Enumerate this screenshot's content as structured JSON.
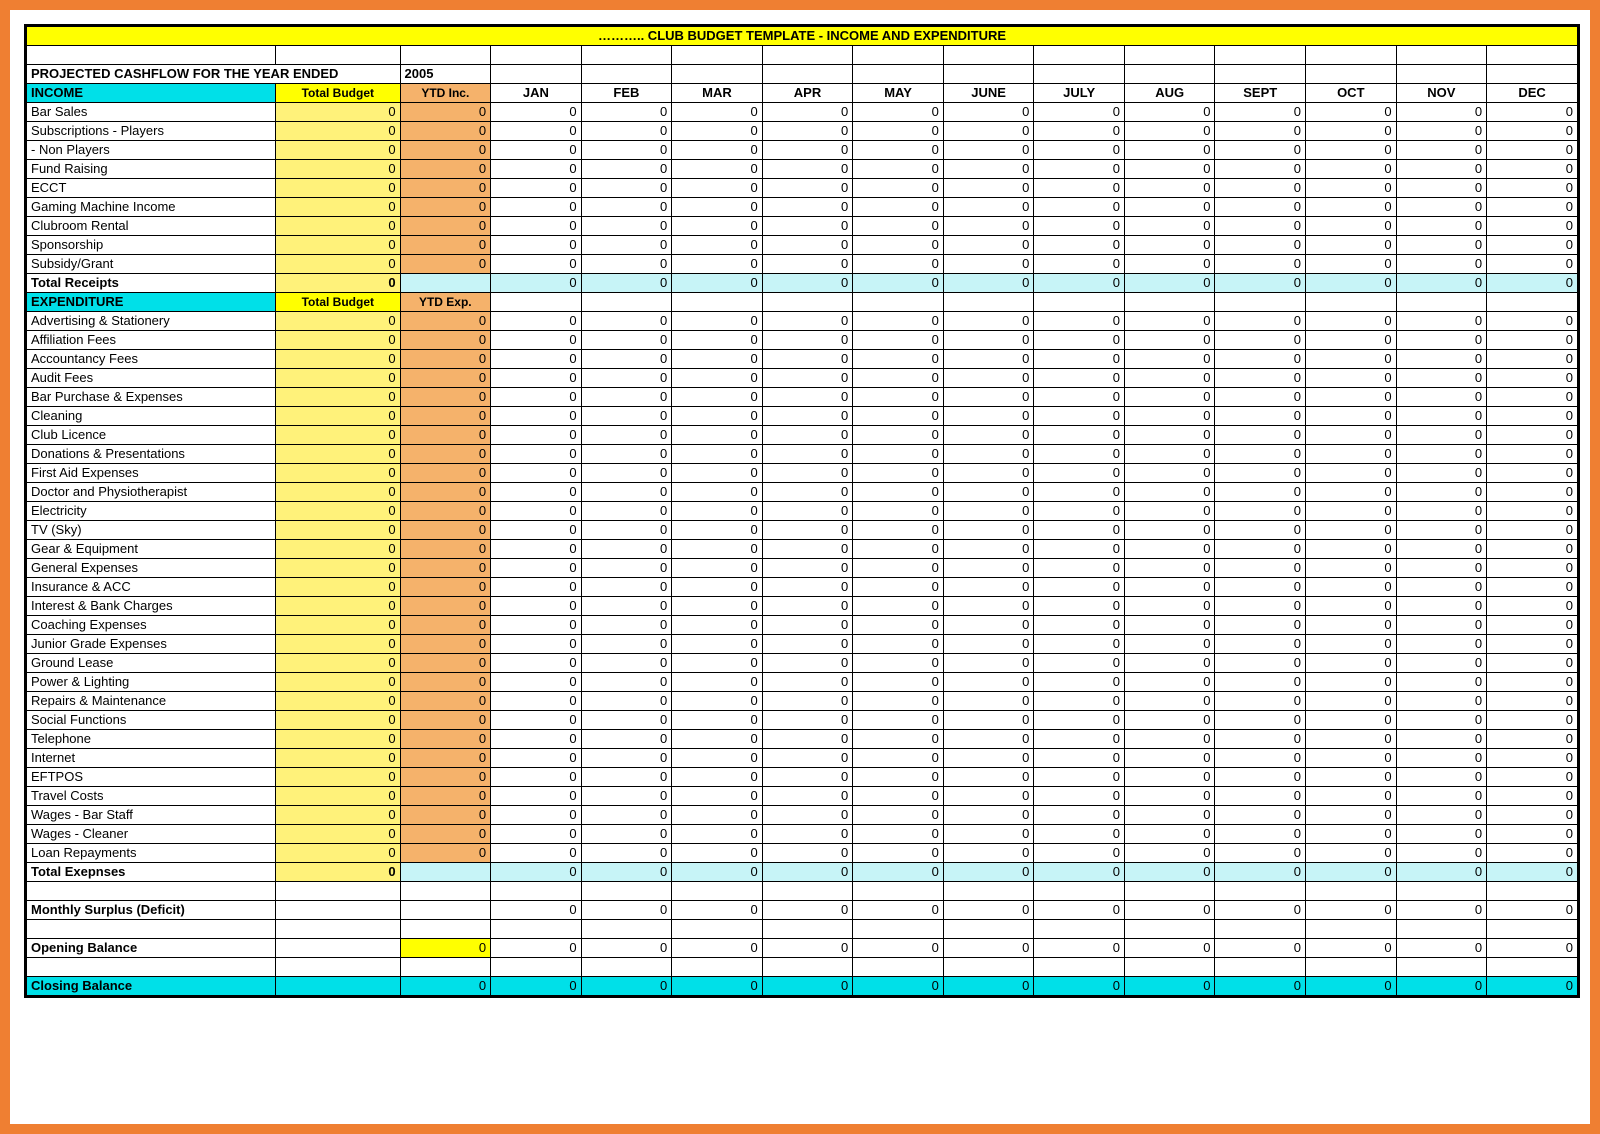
{
  "title": "………..  CLUB BUDGET TEMPLATE - INCOME AND EXPENDITURE",
  "projected_line": {
    "prefix": "PROJECTED CASHFLOW FOR THE YEAR ENDED",
    "year": "2005"
  },
  "headers": {
    "income_section": "INCOME",
    "expenditure_section": "EXPENDITURE",
    "total_budget": "Total Budget",
    "ytd_inc": "YTD Inc.",
    "ytd_exp": "YTD Exp.",
    "months": [
      "JAN",
      "FEB",
      "MAR",
      "APR",
      "MAY",
      "JUNE",
      "JULY",
      "AUG",
      "SEPT",
      "OCT",
      "NOV",
      "DEC"
    ]
  },
  "income_rows": [
    {
      "label": "Bar Sales",
      "tbud": "0",
      "ytd": "0",
      "m": [
        "0",
        "0",
        "0",
        "0",
        "0",
        "0",
        "0",
        "0",
        "0",
        "0",
        "0",
        "0"
      ]
    },
    {
      "label": "Subscriptions - Players",
      "tbud": "0",
      "ytd": "0",
      "m": [
        "0",
        "0",
        "0",
        "0",
        "0",
        "0",
        "0",
        "0",
        "0",
        "0",
        "0",
        "0"
      ]
    },
    {
      "label": "- Non Players",
      "indent": true,
      "tbud": "0",
      "ytd": "0",
      "m": [
        "0",
        "0",
        "0",
        "0",
        "0",
        "0",
        "0",
        "0",
        "0",
        "0",
        "0",
        "0"
      ]
    },
    {
      "label": "Fund Raising",
      "tbud": "0",
      "ytd": "0",
      "m": [
        "0",
        "0",
        "0",
        "0",
        "0",
        "0",
        "0",
        "0",
        "0",
        "0",
        "0",
        "0"
      ]
    },
    {
      "label": "ECCT",
      "tbud": "0",
      "ytd": "0",
      "m": [
        "0",
        "0",
        "0",
        "0",
        "0",
        "0",
        "0",
        "0",
        "0",
        "0",
        "0",
        "0"
      ]
    },
    {
      "label": "Gaming Machine Income",
      "tbud": "0",
      "ytd": "0",
      "m": [
        "0",
        "0",
        "0",
        "0",
        "0",
        "0",
        "0",
        "0",
        "0",
        "0",
        "0",
        "0"
      ]
    },
    {
      "label": "Clubroom Rental",
      "tbud": "0",
      "ytd": "0",
      "m": [
        "0",
        "0",
        "0",
        "0",
        "0",
        "0",
        "0",
        "0",
        "0",
        "0",
        "0",
        "0"
      ]
    },
    {
      "label": "Sponsorship",
      "tbud": "0",
      "ytd": "0",
      "m": [
        "0",
        "0",
        "0",
        "0",
        "0",
        "0",
        "0",
        "0",
        "0",
        "0",
        "0",
        "0"
      ]
    },
    {
      "label": "Subsidy/Grant",
      "tbud": "0",
      "ytd": "0",
      "m": [
        "0",
        "0",
        "0",
        "0",
        "0",
        "0",
        "0",
        "0",
        "0",
        "0",
        "0",
        "0"
      ]
    }
  ],
  "income_total": {
    "label": "Total Receipts",
    "tbud": "0",
    "ytd": "",
    "m": [
      "0",
      "0",
      "0",
      "0",
      "0",
      "0",
      "0",
      "0",
      "0",
      "0",
      "0",
      "0"
    ]
  },
  "expenditure_rows": [
    {
      "label": "Advertising & Stationery",
      "tbud": "0",
      "ytd": "0",
      "m": [
        "0",
        "0",
        "0",
        "0",
        "0",
        "0",
        "0",
        "0",
        "0",
        "0",
        "0",
        "0"
      ]
    },
    {
      "label": "Affiliation Fees",
      "tbud": "0",
      "ytd": "0",
      "m": [
        "0",
        "0",
        "0",
        "0",
        "0",
        "0",
        "0",
        "0",
        "0",
        "0",
        "0",
        "0"
      ]
    },
    {
      "label": "Accountancy Fees",
      "tbud": "0",
      "ytd": "0",
      "m": [
        "0",
        "0",
        "0",
        "0",
        "0",
        "0",
        "0",
        "0",
        "0",
        "0",
        "0",
        "0"
      ]
    },
    {
      "label": "Audit Fees",
      "tbud": "0",
      "ytd": "0",
      "m": [
        "0",
        "0",
        "0",
        "0",
        "0",
        "0",
        "0",
        "0",
        "0",
        "0",
        "0",
        "0"
      ]
    },
    {
      "label": "Bar Purchase & Expenses",
      "tbud": "0",
      "ytd": "0",
      "m": [
        "0",
        "0",
        "0",
        "0",
        "0",
        "0",
        "0",
        "0",
        "0",
        "0",
        "0",
        "0"
      ]
    },
    {
      "label": "Cleaning",
      "tbud": "0",
      "ytd": "0",
      "m": [
        "0",
        "0",
        "0",
        "0",
        "0",
        "0",
        "0",
        "0",
        "0",
        "0",
        "0",
        "0"
      ]
    },
    {
      "label": "Club Licence",
      "tbud": "0",
      "ytd": "0",
      "m": [
        "0",
        "0",
        "0",
        "0",
        "0",
        "0",
        "0",
        "0",
        "0",
        "0",
        "0",
        "0"
      ]
    },
    {
      "label": "Donations & Presentations",
      "tbud": "0",
      "ytd": "0",
      "m": [
        "0",
        "0",
        "0",
        "0",
        "0",
        "0",
        "0",
        "0",
        "0",
        "0",
        "0",
        "0"
      ]
    },
    {
      "label": "First Aid Expenses",
      "tbud": "0",
      "ytd": "0",
      "m": [
        "0",
        "0",
        "0",
        "0",
        "0",
        "0",
        "0",
        "0",
        "0",
        "0",
        "0",
        "0"
      ]
    },
    {
      "label": "Doctor and Physiotherapist",
      "tbud": "0",
      "ytd": "0",
      "m": [
        "0",
        "0",
        "0",
        "0",
        "0",
        "0",
        "0",
        "0",
        "0",
        "0",
        "0",
        "0"
      ]
    },
    {
      "label": "Electricity",
      "tbud": "0",
      "ytd": "0",
      "m": [
        "0",
        "0",
        "0",
        "0",
        "0",
        "0",
        "0",
        "0",
        "0",
        "0",
        "0",
        "0"
      ]
    },
    {
      "label": "TV (Sky)",
      "tbud": "0",
      "ytd": "0",
      "m": [
        "0",
        "0",
        "0",
        "0",
        "0",
        "0",
        "0",
        "0",
        "0",
        "0",
        "0",
        "0"
      ]
    },
    {
      "label": "Gear & Equipment",
      "tbud": "0",
      "ytd": "0",
      "m": [
        "0",
        "0",
        "0",
        "0",
        "0",
        "0",
        "0",
        "0",
        "0",
        "0",
        "0",
        "0"
      ]
    },
    {
      "label": "General Expenses",
      "tbud": "0",
      "ytd": "0",
      "m": [
        "0",
        "0",
        "0",
        "0",
        "0",
        "0",
        "0",
        "0",
        "0",
        "0",
        "0",
        "0"
      ]
    },
    {
      "label": "Insurance & ACC",
      "tbud": "0",
      "ytd": "0",
      "m": [
        "0",
        "0",
        "0",
        "0",
        "0",
        "0",
        "0",
        "0",
        "0",
        "0",
        "0",
        "0"
      ]
    },
    {
      "label": "Interest & Bank Charges",
      "tbud": "0",
      "ytd": "0",
      "m": [
        "0",
        "0",
        "0",
        "0",
        "0",
        "0",
        "0",
        "0",
        "0",
        "0",
        "0",
        "0"
      ]
    },
    {
      "label": "Coaching Expenses",
      "tbud": "0",
      "ytd": "0",
      "m": [
        "0",
        "0",
        "0",
        "0",
        "0",
        "0",
        "0",
        "0",
        "0",
        "0",
        "0",
        "0"
      ]
    },
    {
      "label": "Junior Grade Expenses",
      "tbud": "0",
      "ytd": "0",
      "m": [
        "0",
        "0",
        "0",
        "0",
        "0",
        "0",
        "0",
        "0",
        "0",
        "0",
        "0",
        "0"
      ]
    },
    {
      "label": "Ground Lease",
      "tbud": "0",
      "ytd": "0",
      "m": [
        "0",
        "0",
        "0",
        "0",
        "0",
        "0",
        "0",
        "0",
        "0",
        "0",
        "0",
        "0"
      ]
    },
    {
      "label": "Power & Lighting",
      "tbud": "0",
      "ytd": "0",
      "m": [
        "0",
        "0",
        "0",
        "0",
        "0",
        "0",
        "0",
        "0",
        "0",
        "0",
        "0",
        "0"
      ]
    },
    {
      "label": "Repairs & Maintenance",
      "tbud": "0",
      "ytd": "0",
      "m": [
        "0",
        "0",
        "0",
        "0",
        "0",
        "0",
        "0",
        "0",
        "0",
        "0",
        "0",
        "0"
      ]
    },
    {
      "label": "Social Functions",
      "tbud": "0",
      "ytd": "0",
      "m": [
        "0",
        "0",
        "0",
        "0",
        "0",
        "0",
        "0",
        "0",
        "0",
        "0",
        "0",
        "0"
      ]
    },
    {
      "label": "Telephone",
      "tbud": "0",
      "ytd": "0",
      "m": [
        "0",
        "0",
        "0",
        "0",
        "0",
        "0",
        "0",
        "0",
        "0",
        "0",
        "0",
        "0"
      ]
    },
    {
      "label": "Internet",
      "tbud": "0",
      "ytd": "0",
      "m": [
        "0",
        "0",
        "0",
        "0",
        "0",
        "0",
        "0",
        "0",
        "0",
        "0",
        "0",
        "0"
      ]
    },
    {
      "label": "EFTPOS",
      "tbud": "0",
      "ytd": "0",
      "m": [
        "0",
        "0",
        "0",
        "0",
        "0",
        "0",
        "0",
        "0",
        "0",
        "0",
        "0",
        "0"
      ]
    },
    {
      "label": "Travel Costs",
      "tbud": "0",
      "ytd": "0",
      "m": [
        "0",
        "0",
        "0",
        "0",
        "0",
        "0",
        "0",
        "0",
        "0",
        "0",
        "0",
        "0"
      ]
    },
    {
      "label": "Wages - Bar Staff",
      "tbud": "0",
      "ytd": "0",
      "m": [
        "0",
        "0",
        "0",
        "0",
        "0",
        "0",
        "0",
        "0",
        "0",
        "0",
        "0",
        "0"
      ]
    },
    {
      "label": "Wages - Cleaner",
      "tbud": "0",
      "ytd": "0",
      "m": [
        "0",
        "0",
        "0",
        "0",
        "0",
        "0",
        "0",
        "0",
        "0",
        "0",
        "0",
        "0"
      ]
    },
    {
      "label": "Loan Repayments",
      "tbud": "0",
      "ytd": "0",
      "m": [
        "0",
        "0",
        "0",
        "0",
        "0",
        "0",
        "0",
        "0",
        "0",
        "0",
        "0",
        "0"
      ]
    }
  ],
  "exp_total": {
    "label": "Total  Exepnses",
    "tbud": "0",
    "ytd": "",
    "m": [
      "0",
      "0",
      "0",
      "0",
      "0",
      "0",
      "0",
      "0",
      "0",
      "0",
      "0",
      "0"
    ]
  },
  "surplus": {
    "label": "Monthly Surplus (Deficit)",
    "tbud": "",
    "ytd": "",
    "m": [
      "0",
      "0",
      "0",
      "0",
      "0",
      "0",
      "0",
      "0",
      "0",
      "0",
      "0",
      "0"
    ]
  },
  "opening": {
    "label": "Opening Balance",
    "tbud": "",
    "ytd": "0",
    "m": [
      "0",
      "0",
      "0",
      "0",
      "0",
      "0",
      "0",
      "0",
      "0",
      "0",
      "0",
      "0"
    ]
  },
  "closing": {
    "label": "Closing Balance",
    "tbud": "",
    "ytd": "0",
    "m": [
      "0",
      "0",
      "0",
      "0",
      "0",
      "0",
      "0",
      "0",
      "0",
      "0",
      "0",
      "0"
    ]
  }
}
